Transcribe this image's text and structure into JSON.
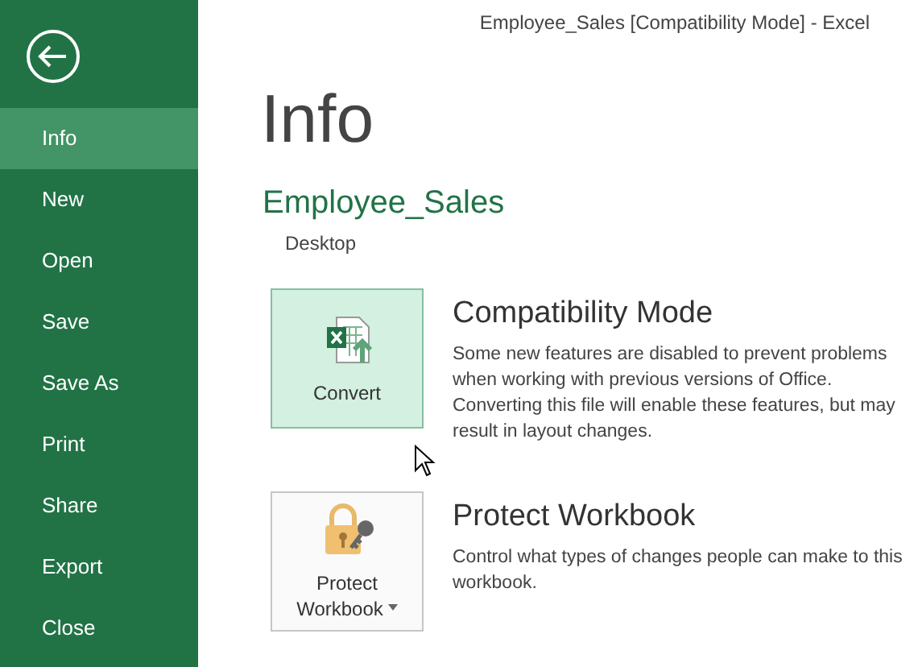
{
  "window": {
    "title": "Employee_Sales  [Compatibility Mode] - Excel"
  },
  "sidebar": {
    "items": [
      {
        "label": "Info",
        "selected": true
      },
      {
        "label": "New",
        "selected": false
      },
      {
        "label": "Open",
        "selected": false
      },
      {
        "label": "Save",
        "selected": false
      },
      {
        "label": "Save As",
        "selected": false
      },
      {
        "label": "Print",
        "selected": false
      },
      {
        "label": "Share",
        "selected": false
      },
      {
        "label": "Export",
        "selected": false
      },
      {
        "label": "Close",
        "selected": false
      }
    ]
  },
  "page": {
    "heading": "Info",
    "file_name": "Employee_Sales",
    "location": "Desktop"
  },
  "sections": [
    {
      "kind": "convert",
      "button": {
        "label": [
          "Convert"
        ],
        "highlighted": true,
        "dropdown": false
      },
      "title": "Compatibility Mode",
      "text": "Some new features are disabled to prevent problems when working with previous versions of Office. Converting this file will enable these features, but may result in layout changes."
    },
    {
      "kind": "protect",
      "button": {
        "label": [
          "Protect",
          "Workbook"
        ],
        "highlighted": false,
        "dropdown": true
      },
      "title": "Protect Workbook",
      "text": "Control what types of changes people can make to this workbook."
    }
  ]
}
